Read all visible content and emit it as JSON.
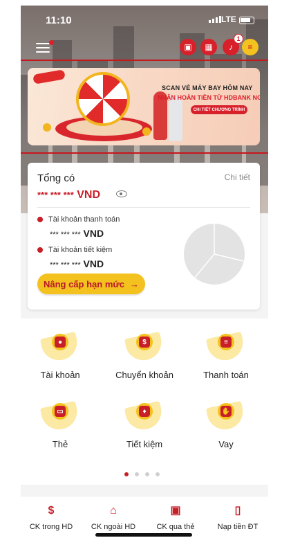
{
  "status": {
    "time": "11:10",
    "network": "LTE"
  },
  "header": {
    "notif_count": "1"
  },
  "banner": {
    "line1": "SCAN VÉ MÁY BAY HÔM NAY",
    "line2": "NHẬN HOÀN TIỀN TỪ HDBANK NGAY",
    "cta": "CHI TIẾT CHƯƠNG TRÌNH"
  },
  "balance": {
    "title": "Tổng có",
    "detail": "Chi tiết",
    "masked": "*** *** ***",
    "currency": "VND",
    "accounts": [
      {
        "name": "Tài khoản thanh toán",
        "masked": "*** *** ***",
        "currency": "VND"
      },
      {
        "name": "Tài khoản tiết kiệm",
        "masked": "*** *** ***",
        "currency": "VND"
      }
    ],
    "upgrade": "Nâng cấp hạn mức"
  },
  "services": [
    {
      "label": "Tài khoản",
      "icon": "account-icon"
    },
    {
      "label": "Chuyển khoản",
      "icon": "transfer-icon"
    },
    {
      "label": "Thanh toán",
      "icon": "payment-icon"
    },
    {
      "label": "Thẻ",
      "icon": "card-icon"
    },
    {
      "label": "Tiết kiệm",
      "icon": "savings-icon"
    },
    {
      "label": "Vay",
      "icon": "loan-icon"
    }
  ],
  "bottom_nav": [
    {
      "label": "CK trong HD",
      "icon": "internal-transfer-icon"
    },
    {
      "label": "CK ngoài HD",
      "icon": "bank-icon"
    },
    {
      "label": "CK qua thẻ",
      "icon": "card-transfer-icon"
    },
    {
      "label": "Nạp tiền ĐT",
      "icon": "phone-topup-icon"
    }
  ],
  "colors": {
    "brand": "#c81e28",
    "accent": "#f4c21e"
  }
}
